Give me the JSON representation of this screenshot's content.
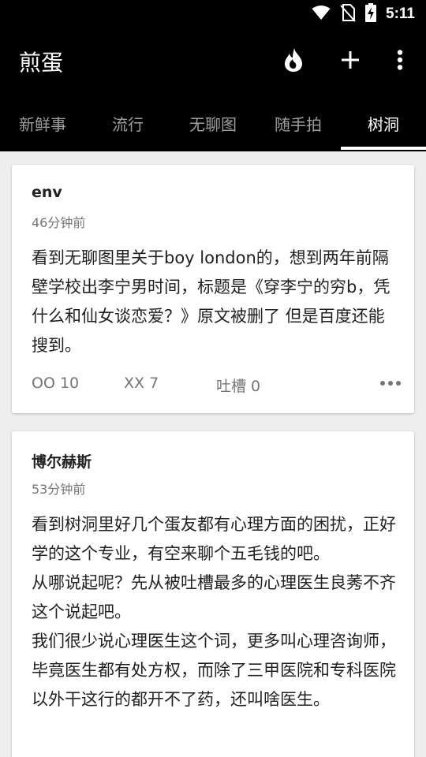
{
  "status_bar": {
    "time": "5:11",
    "icons": [
      "wifi-icon",
      "no-sim-icon",
      "battery-charging-icon"
    ]
  },
  "app_bar": {
    "title": "煎蛋",
    "actions": [
      "hot-icon",
      "add-icon",
      "more-vert-icon"
    ]
  },
  "tabs": [
    {
      "label": "新鲜事",
      "active": false
    },
    {
      "label": "流行",
      "active": false
    },
    {
      "label": "无聊图",
      "active": false
    },
    {
      "label": "随手拍",
      "active": false
    },
    {
      "label": "树洞",
      "active": true
    }
  ],
  "posts": [
    {
      "author": "env",
      "time": "46分钟前",
      "content": "看到无聊图里关于boy london的，想到两年前隔壁学校出李宁男时间，标题是《穿李宁的穷b，凭什么和仙女谈恋爱？》原文被删了 但是百度还能搜到。",
      "oo": "OO 10",
      "xx": "XX 7",
      "tucao": "吐槽 0"
    },
    {
      "author": "博尔赫斯",
      "time": "53分钟前",
      "content": "看到树洞里好几个蛋友都有心理方面的困扰，正好学的这个专业，有空来聊个五毛钱的吧。\n从哪说起呢？先从被吐槽最多的心理医生良莠不齐这个说起吧。\n我们很少说心理医生这个词，更多叫心理咨询师，毕竟医生都有处方权，而除了三甲医院和专科医院以外干这行的都开不了药，还叫啥医生。"
    }
  ],
  "colors": {
    "bar_background": "#000000",
    "tab_inactive": "#9e9e9e",
    "tab_active": "#ffffff",
    "page_background": "#eeeeee",
    "text_secondary": "#757575"
  }
}
